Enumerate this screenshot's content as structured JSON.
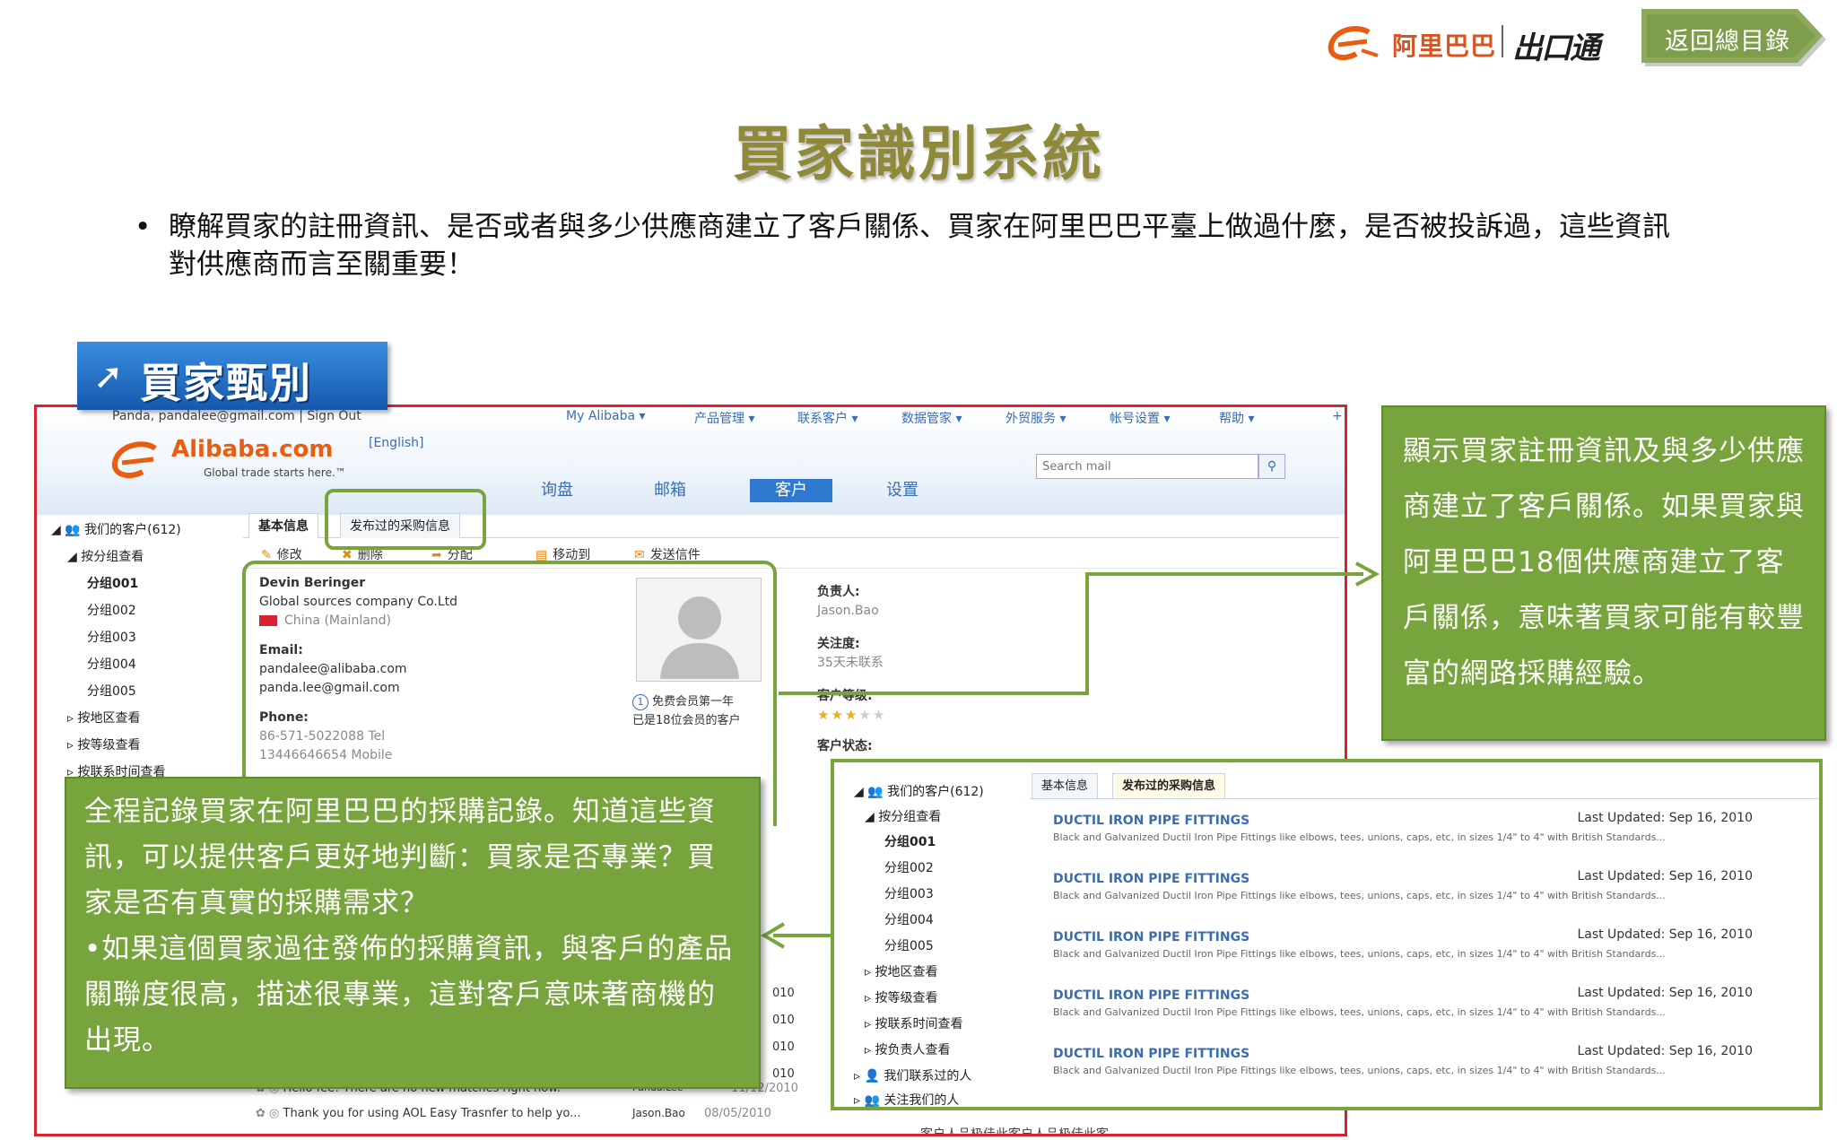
{
  "header": {
    "brand_cn": "阿里巴巴",
    "brand_product": "出口通",
    "back_button": "返回總目錄"
  },
  "slide": {
    "title": "買家識別系統",
    "bullet_dot": "•",
    "bullet_text": "瞭解買家的註冊資訊、是否或者與多少供應商建立了客戶關係、買家在阿里巴巴平臺上做過什麼，是否被投訴過，這些資訊對供應商而言至關重要！",
    "section_tag": "買家甄別",
    "section_arrow": "➚"
  },
  "screenshot": {
    "user_info": "Panda, pandalee@gmail.com | Sign Out",
    "nav": [
      "My Alibaba ▾",
      "产品管理 ▾",
      "联系客户 ▾",
      "数据管家 ▾",
      "外贸服务 ▾",
      "帐号设置 ▾",
      "帮助 ▾"
    ],
    "nav_plus": "+",
    "logo_word": "Alibaba.com",
    "logo_tagline": "Global trade starts here.™",
    "lang": "[English]",
    "search_placeholder": "Search mail",
    "search_icon": "magnifier-icon",
    "main_tabs": [
      "询盘",
      "邮箱",
      "客户",
      "设置"
    ],
    "sidebar": {
      "root": "我们的客户(612)",
      "group_by": "按分组查看",
      "groups": [
        "分组001",
        "分组002",
        "分组003",
        "分组004",
        "分组005"
      ],
      "others": [
        "按地区查看",
        "按等级查看",
        "按联系时间查看"
      ]
    },
    "tabs": [
      "基本信息",
      "发布过的采购信息"
    ],
    "toolbar": [
      "修改",
      "删除",
      "分配",
      "移动到",
      "发送信件"
    ],
    "contact": {
      "name": "Devin Beringer",
      "company": "Global sources company Co.Ltd",
      "country": "China (Mainland)",
      "email_label": "Email:",
      "email1": "pandalee@alibaba.com",
      "email2": "panda.lee@gmail.com",
      "phone_label": "Phone:",
      "phone1": "86-571-5022088 Tel",
      "phone2": "13446646654 Mobile"
    },
    "member_badge": "1",
    "member_line1": "免费会员第一年",
    "member_line2": "已是18位会员的客户",
    "owner_label": "负责人:",
    "owner_value": "Jason.Bao",
    "attention_label": "关注度:",
    "attention_value": "35天未联系",
    "level_label": "客户等级:",
    "level_stars": 3,
    "level_max": 5,
    "status_label": "客户状态:",
    "mails": [
      {
        "subject": "Hello fee! There are no new matches right now.",
        "sender": "Panda.Lee",
        "date": "11/12/2010"
      },
      {
        "subject": "Thank you for using AOL Easy Trasnfer to help yo...",
        "sender": "Jason.Bao",
        "date": "08/05/2010"
      }
    ],
    "partial_dates": [
      "010",
      "010",
      "010",
      "010"
    ],
    "footer_text": "客户人品极佳此客户人品极佳此客"
  },
  "inset": {
    "sidebar": {
      "root": "我们的客户(612)",
      "group_by": "按分组查看",
      "groups": [
        "分组001",
        "分组002",
        "分组003",
        "分组004",
        "分组005"
      ],
      "others": [
        "按地区查看",
        "按等级查看",
        "按联系时间查看",
        "按负责人查看",
        "我们联系过的人",
        "关注我们的人"
      ]
    },
    "tabs": [
      "基本信息",
      "发布过的采购信息"
    ],
    "purchases": [
      {
        "title": "DUCTIL IRON PIPE FITTINGS",
        "updated": "Last Updated: Sep 16, 2010",
        "desc": "Black and Galvanized Ductil Iron Pipe Fittings like elbows, tees, unions, caps, etc, in sizes 1/4\" to 4\" with British Standards..."
      },
      {
        "title": "DUCTIL IRON PIPE FITTINGS",
        "updated": "Last Updated: Sep 16, 2010",
        "desc": "Black and Galvanized Ductil Iron Pipe Fittings like elbows, tees, unions, caps, etc, in sizes 1/4\" to 4\" with British Standards..."
      },
      {
        "title": "DUCTIL IRON PIPE FITTINGS",
        "updated": "Last Updated: Sep 16, 2010",
        "desc": "Black and Galvanized Ductil Iron Pipe Fittings like elbows, tees, unions, caps, etc, in sizes 1/4\" to 4\" with British Standards..."
      },
      {
        "title": "DUCTIL IRON PIPE FITTINGS",
        "updated": "Last Updated: Sep 16, 2010",
        "desc": "Black and Galvanized Ductil Iron Pipe Fittings like elbows, tees, unions, caps, etc, in sizes 1/4\" to 4\" with British Standards..."
      },
      {
        "title": "DUCTIL IRON PIPE FITTINGS",
        "updated": "Last Updated: Sep 16, 2010",
        "desc": "Black and Galvanized Ductil Iron Pipe Fittings like elbows, tees, unions, caps, etc, in sizes 1/4\" to 4\" with British Standards..."
      }
    ]
  },
  "callouts": {
    "right": "顯示買家註冊資訊及與多少供應商建立了客戶關係。如果買家與阿里巴巴18個供應商建立了客戶關係，意味著買家可能有較豐富的網路採購經驗。",
    "left_p1": "全程記錄買家在阿里巴巴的採購記錄。知道這些資訊，可以提供客戶更好地判斷：買家是否專業？買家是否有真實的採購需求？",
    "left_p2": "•如果這個買家過往發佈的採購資訊，與客戶的產品關聯度很高，描述很專業，這對客戶意味著商機的出現。"
  },
  "colors": {
    "callout_green": "#77a43d",
    "title_olive": "#8f8a3a",
    "frame_red": "#d9232f",
    "tag_blue": "#1f6fc8",
    "link_blue": "#3a6db0"
  }
}
